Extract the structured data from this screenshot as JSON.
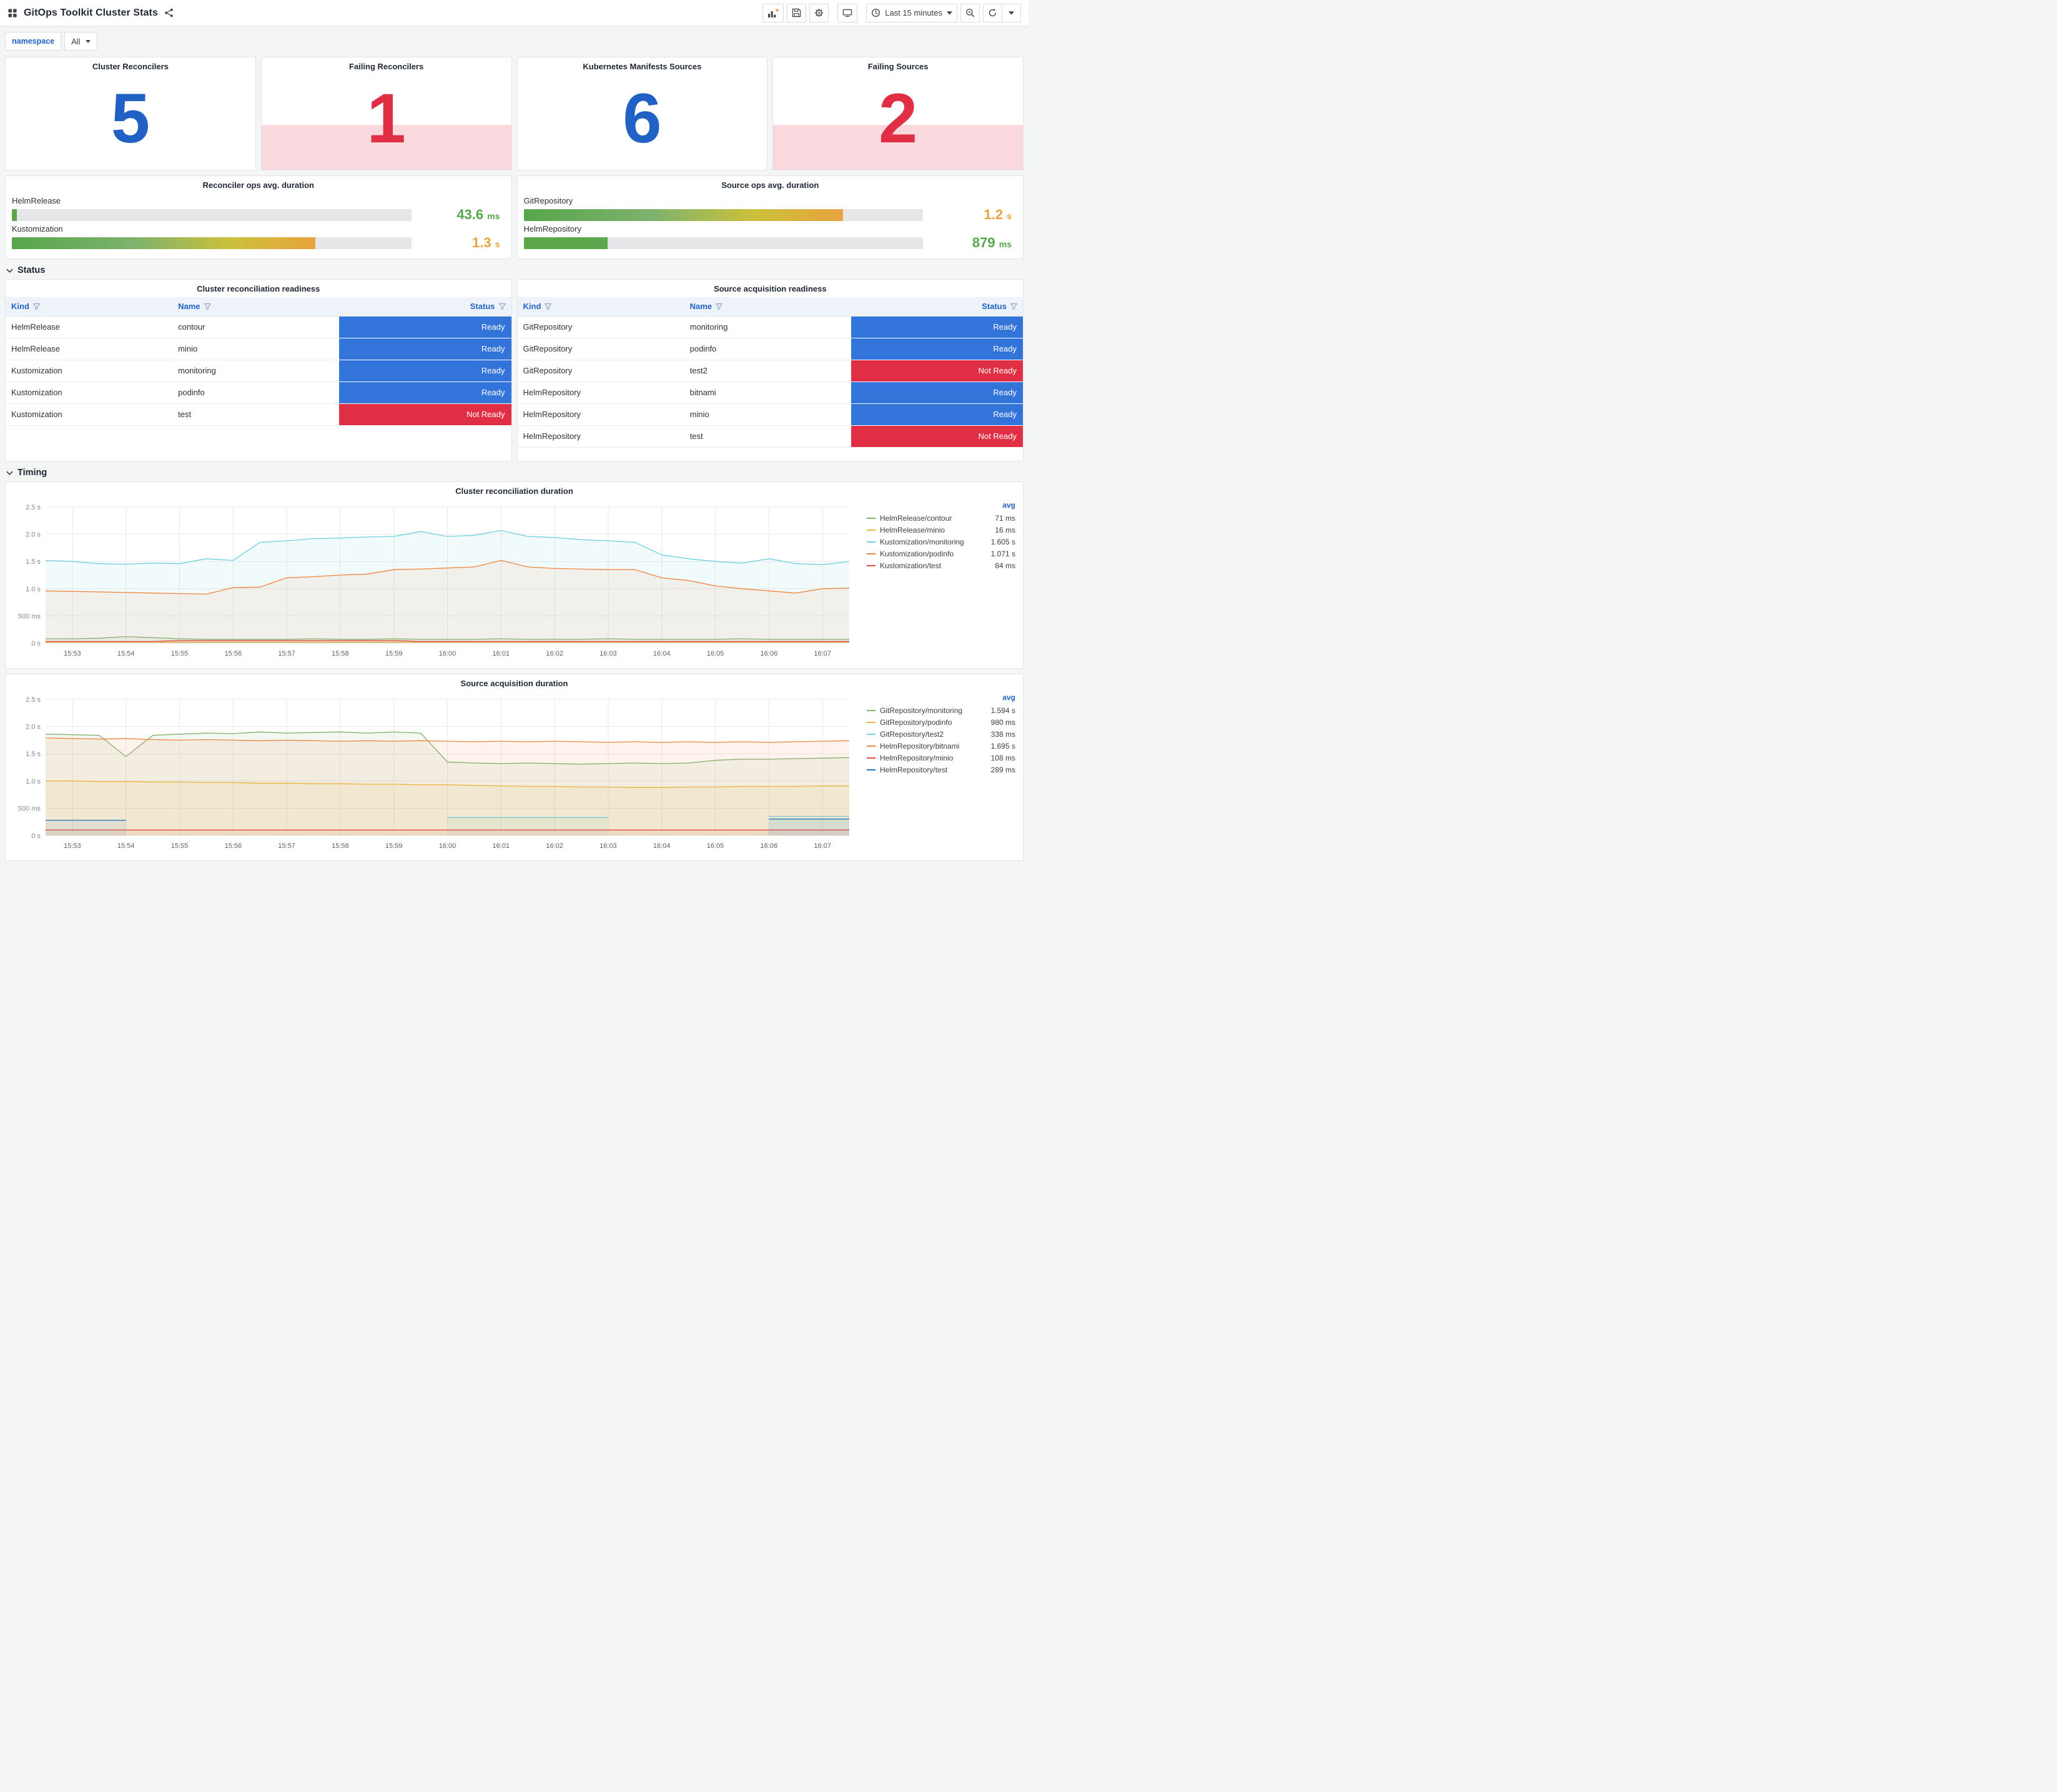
{
  "header": {
    "title": "GitOps Toolkit Cluster Stats",
    "time_picker": "Last 15 minutes"
  },
  "variables": {
    "label": "namespace",
    "value": "All"
  },
  "stat_panels": [
    {
      "title": "Cluster Reconcilers",
      "value": "5",
      "state": "ok"
    },
    {
      "title": "Failing Reconcilers",
      "value": "1",
      "state": "alert"
    },
    {
      "title": "Kubernetes Manifests Sources",
      "value": "6",
      "state": "ok"
    },
    {
      "title": "Failing Sources",
      "value": "2",
      "state": "alert"
    }
  ],
  "gauge_panels": [
    {
      "title": "Reconciler ops avg. duration",
      "bars": [
        {
          "label": "HelmRelease",
          "value": "43.6",
          "unit": "ms",
          "pct": 1.2,
          "fill": "solid",
          "value_color": "#56A64B"
        },
        {
          "label": "Kustomization",
          "value": "1.3",
          "unit": "s",
          "pct": 76,
          "fill": "gradient",
          "value_color": "#E8A33D"
        }
      ]
    },
    {
      "title": "Source ops avg. duration",
      "bars": [
        {
          "label": "GitRepository",
          "value": "1.2",
          "unit": "s",
          "pct": 80,
          "fill": "gradient",
          "value_color": "#E8A33D"
        },
        {
          "label": "HelmRepository",
          "value": "879",
          "unit": "ms",
          "pct": 21,
          "fill": "solid",
          "value_color": "#56A64B"
        }
      ]
    }
  ],
  "sections": {
    "status": "Status",
    "timing": "Timing"
  },
  "tables": [
    {
      "title": "Cluster reconciliation readiness",
      "columns": [
        "Kind",
        "Name",
        "Status"
      ],
      "rows": [
        [
          "HelmRelease",
          "contour",
          "Ready"
        ],
        [
          "HelmRelease",
          "minio",
          "Ready"
        ],
        [
          "Kustomization",
          "monitoring",
          "Ready"
        ],
        [
          "Kustomization",
          "podinfo",
          "Ready"
        ],
        [
          "Kustomization",
          "test",
          "Not Ready"
        ]
      ]
    },
    {
      "title": "Source acquisition readiness",
      "columns": [
        "Kind",
        "Name",
        "Status"
      ],
      "rows": [
        [
          "GitRepository",
          "monitoring",
          "Ready"
        ],
        [
          "GitRepository",
          "podinfo",
          "Ready"
        ],
        [
          "GitRepository",
          "test2",
          "Not Ready"
        ],
        [
          "HelmRepository",
          "bitnami",
          "Ready"
        ],
        [
          "HelmRepository",
          "minio",
          "Ready"
        ],
        [
          "HelmRepository",
          "test",
          "Not Ready"
        ]
      ]
    }
  ],
  "chart_data": [
    {
      "type": "line",
      "title": "Cluster reconciliation duration",
      "ylim": [
        0,
        2.5
      ],
      "y_tick_labels": [
        "0 s",
        "500 ms",
        "1.0 s",
        "1.5 s",
        "2.0 s",
        "2.5 s"
      ],
      "x_ticks": [
        "15:53",
        "15:54",
        "15:55",
        "15:56",
        "15:57",
        "15:58",
        "15:59",
        "16:00",
        "16:01",
        "16:02",
        "16:03",
        "16:04",
        "16:05",
        "16:06",
        "16:07"
      ],
      "legend_header": "avg",
      "legend_position": "right",
      "grid": true,
      "series": [
        {
          "name": "HelmRelease/contour",
          "avg": "71 ms",
          "color": "#7EB26D",
          "values": [
            0.08,
            0.08,
            0.09,
            0.12,
            0.1,
            0.08,
            0.07,
            0.07,
            0.07,
            0.07,
            0.08,
            0.07,
            0.07,
            0.08,
            0.07,
            0.07,
            0.07,
            0.08,
            0.07,
            0.07,
            0.07,
            0.08,
            0.07,
            0.07,
            0.07,
            0.07,
            0.08,
            0.07,
            0.07,
            0.07,
            0.07
          ]
        },
        {
          "name": "HelmRelease/minio",
          "avg": "16 ms",
          "color": "#EAB839",
          "values": [
            0.02,
            0.02,
            0.02,
            0.02,
            0.02,
            0.02,
            0.02,
            0.02,
            0.02,
            0.02,
            0.02,
            0.02,
            0.02,
            0.02,
            0.02,
            0.02,
            0.02,
            0.02,
            0.02,
            0.02,
            0.02,
            0.02,
            0.02,
            0.02,
            0.02,
            0.02,
            0.02,
            0.02,
            0.02,
            0.02,
            0.02
          ]
        },
        {
          "name": "Kustomization/monitoring",
          "avg": "1.605 s",
          "color": "#6ED0E0",
          "values": [
            1.52,
            1.5,
            1.46,
            1.45,
            1.47,
            1.46,
            1.55,
            1.52,
            1.85,
            1.88,
            1.92,
            1.93,
            1.95,
            1.96,
            2.05,
            1.96,
            1.98,
            2.07,
            1.96,
            1.94,
            1.9,
            1.88,
            1.85,
            1.62,
            1.55,
            1.5,
            1.47,
            1.55,
            1.46,
            1.44,
            1.5
          ]
        },
        {
          "name": "Kustomization/podinfo",
          "avg": "1.071 s",
          "color": "#EF843C",
          "values": [
            0.96,
            0.95,
            0.94,
            0.93,
            0.92,
            0.91,
            0.9,
            1.02,
            1.03,
            1.2,
            1.22,
            1.25,
            1.27,
            1.35,
            1.36,
            1.38,
            1.4,
            1.52,
            1.4,
            1.37,
            1.36,
            1.35,
            1.35,
            1.2,
            1.15,
            1.05,
            1.0,
            0.96,
            0.92,
            1.0,
            1.01
          ]
        },
        {
          "name": "Kustomization/test",
          "avg": "84 ms",
          "color": "#E24D42",
          "values": [
            0.03,
            0.03,
            0.03,
            0.03,
            0.03,
            0.05,
            0.05,
            0.05,
            0.05,
            0.05,
            0.05,
            0.05,
            0.05,
            0.05,
            0.03,
            0.03,
            0.03,
            0.03,
            0.03,
            0.03,
            0.03,
            0.03,
            0.03,
            0.03,
            0.03,
            0.03,
            0.03,
            0.03,
            0.03,
            0.03,
            0.03
          ]
        }
      ]
    },
    {
      "type": "line",
      "title": "Source acquisition duration",
      "ylim": [
        0,
        2.5
      ],
      "y_tick_labels": [
        "0 s",
        "500 ms",
        "1.0 s",
        "1.5 s",
        "2.0 s",
        "2.5 s"
      ],
      "x_ticks": [
        "15:53",
        "15:54",
        "15:55",
        "15:56",
        "15:57",
        "15:58",
        "15:59",
        "16:00",
        "16:01",
        "16:02",
        "16:03",
        "16:04",
        "16:05",
        "16:06",
        "16:07"
      ],
      "legend_header": "avg",
      "legend_position": "right",
      "grid": true,
      "series": [
        {
          "name": "GitRepository/monitoring",
          "avg": "1.594 s",
          "color": "#7EB26D",
          "values": [
            1.86,
            1.85,
            1.84,
            1.45,
            1.84,
            1.86,
            1.88,
            1.87,
            1.9,
            1.88,
            1.89,
            1.9,
            1.88,
            1.9,
            1.88,
            1.35,
            1.33,
            1.32,
            1.33,
            1.32,
            1.31,
            1.32,
            1.33,
            1.32,
            1.33,
            1.38,
            1.4,
            1.4,
            1.41,
            1.42,
            1.43
          ]
        },
        {
          "name": "GitRepository/podinfo",
          "avg": "980 ms",
          "color": "#EAB839",
          "values": [
            1.0,
            1.0,
            0.99,
            0.99,
            0.98,
            0.98,
            0.97,
            0.97,
            0.96,
            0.96,
            0.95,
            0.95,
            0.94,
            0.94,
            0.93,
            0.93,
            0.92,
            0.91,
            0.9,
            0.9,
            0.89,
            0.89,
            0.88,
            0.88,
            0.89,
            0.89,
            0.9,
            0.9,
            0.9,
            0.91,
            0.91
          ]
        },
        {
          "name": "GitRepository/test2",
          "avg": "338 ms",
          "color": "#6ED0E0",
          "values": [
            null,
            null,
            null,
            null,
            null,
            null,
            null,
            null,
            null,
            null,
            null,
            null,
            null,
            null,
            null,
            0.33,
            0.33,
            0.33,
            0.33,
            0.33,
            0.33,
            0.33,
            null,
            null,
            null,
            null,
            null,
            0.35,
            0.35,
            0.35,
            0.35
          ]
        },
        {
          "name": "HelmRepository/bitnami",
          "avg": "1.695 s",
          "color": "#EF843C",
          "values": [
            1.79,
            1.78,
            1.77,
            1.78,
            1.76,
            1.75,
            1.76,
            1.75,
            1.74,
            1.75,
            1.74,
            1.73,
            1.74,
            1.73,
            1.74,
            1.73,
            1.72,
            1.73,
            1.72,
            1.73,
            1.72,
            1.71,
            1.72,
            1.71,
            1.72,
            1.71,
            1.72,
            1.71,
            1.72,
            1.73,
            1.74
          ]
        },
        {
          "name": "HelmRepository/minio",
          "avg": "108 ms",
          "color": "#E24D42",
          "values": [
            0.1,
            0.1,
            0.1,
            0.1,
            0.1,
            0.1,
            0.1,
            0.1,
            0.1,
            0.1,
            0.1,
            0.1,
            0.1,
            0.1,
            0.1,
            0.1,
            0.1,
            0.1,
            0.1,
            0.1,
            0.1,
            0.1,
            0.1,
            0.1,
            0.1,
            0.1,
            0.1,
            0.1,
            0.1,
            0.1,
            0.1
          ]
        },
        {
          "name": "HelmRepository/test",
          "avg": "289 ms",
          "color": "#1F78C1",
          "values": [
            0.28,
            0.28,
            0.28,
            0.28,
            null,
            null,
            null,
            null,
            null,
            null,
            null,
            null,
            null,
            null,
            null,
            null,
            null,
            null,
            null,
            null,
            null,
            null,
            null,
            null,
            null,
            null,
            null,
            0.3,
            0.3,
            0.3,
            0.3
          ]
        }
      ]
    }
  ],
  "icons": {
    "left": [
      "apps-icon",
      "share-icon"
    ],
    "right": [
      "add-panel-icon",
      "save-icon",
      "gear-icon",
      "tv-icon",
      "clock-icon",
      "zoom-out-icon",
      "refresh-icon",
      "chevron-down-icon"
    ],
    "table_header": "filter-funnel-icon"
  },
  "colors": {
    "stat_blue": "#2160C4",
    "stat_red": "#E02F44",
    "alert_band": "rgba(224,47,68,0.18)",
    "ready_bg": "#3274D9",
    "not_ready_bg": "#E02F44",
    "gauge_green": "#5CA64B",
    "gauge_gradient": [
      "#56A64B",
      "#7EB26D 40%",
      "#CBC13B 72%",
      "#E8A33D 100%"
    ],
    "header_link_blue": "#1F62C4"
  }
}
